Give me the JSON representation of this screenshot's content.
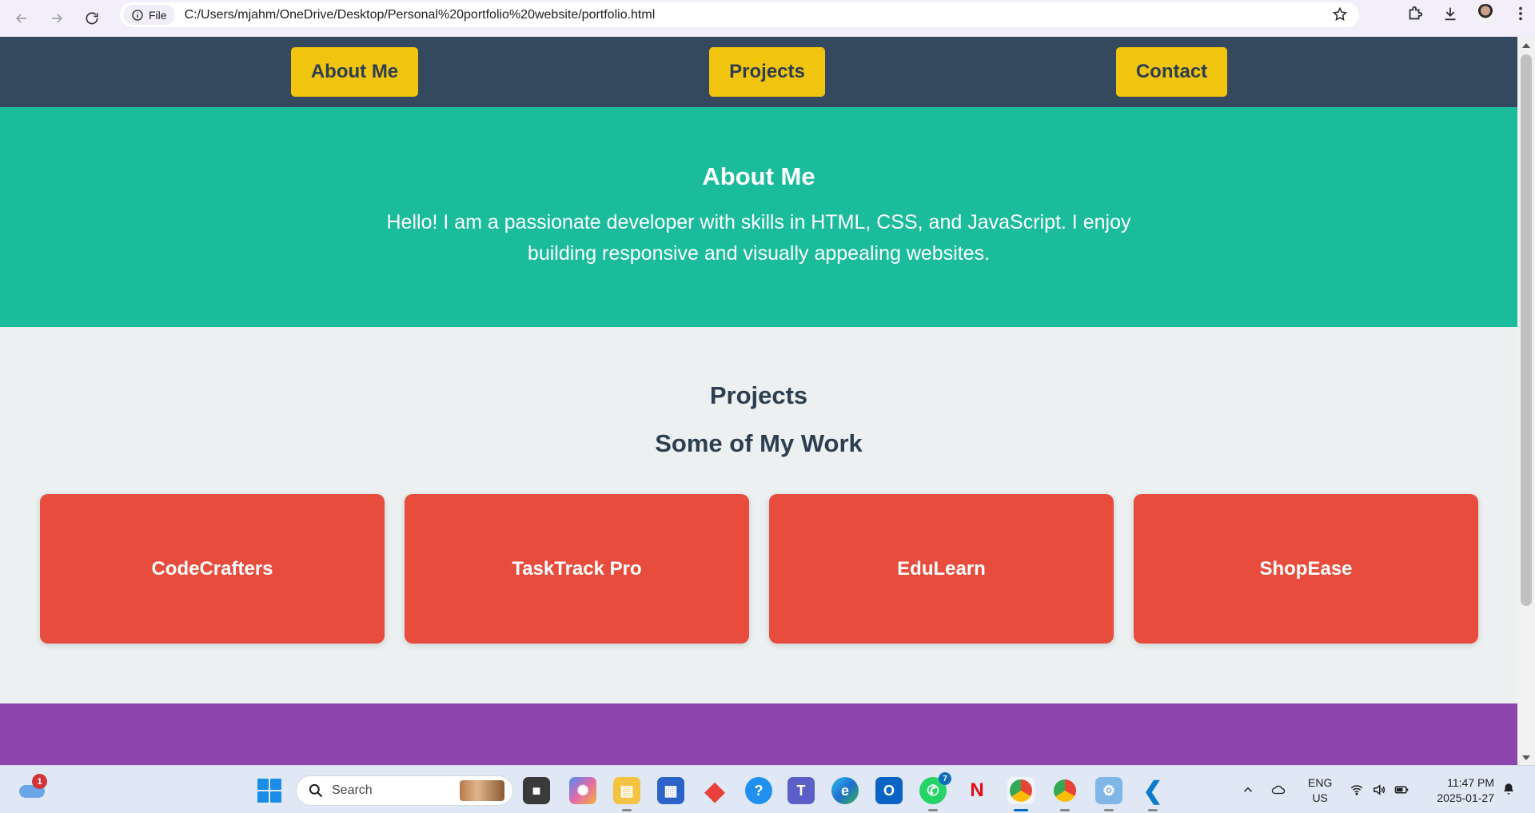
{
  "browser": {
    "site_chip_label": "File",
    "url": "C:/Users/mjahm/OneDrive/Desktop/Personal%20portfolio%20website/portfolio.html"
  },
  "nav": {
    "about_label": "About Me",
    "projects_label": "Projects",
    "contact_label": "Contact"
  },
  "about": {
    "heading": "About Me",
    "text": "Hello! I am a passionate developer with skills in HTML, CSS, and JavaScript. I enjoy building responsive and visually appealing websites."
  },
  "projects": {
    "heading": "Projects",
    "subheading": "Some of My Work",
    "cards": [
      {
        "title": "CodeCrafters"
      },
      {
        "title": "TaskTrack Pro"
      },
      {
        "title": "EduLearn"
      },
      {
        "title": "ShopEase"
      }
    ]
  },
  "colors": {
    "nav_bg": "#34495e",
    "nav_button": "#f1c40f",
    "about_bg": "#1abc9c",
    "projects_bg": "#ecf0f1",
    "card_bg": "#e74c3c",
    "contact_bg": "#8e44ad"
  },
  "taskbar": {
    "weather_badge": "1",
    "search_placeholder": "Search",
    "apps": [
      {
        "name": "task-view"
      },
      {
        "name": "copilot"
      },
      {
        "name": "file-explorer"
      },
      {
        "name": "microsoft-store"
      },
      {
        "name": "git-app"
      },
      {
        "name": "help-app"
      },
      {
        "name": "teams"
      },
      {
        "name": "edge"
      },
      {
        "name": "outlook"
      },
      {
        "name": "whatsapp",
        "badge": "7"
      },
      {
        "name": "netflix"
      },
      {
        "name": "chrome-profile"
      },
      {
        "name": "chrome"
      },
      {
        "name": "control-panel"
      },
      {
        "name": "vscode"
      }
    ],
    "lang_primary": "ENG",
    "lang_secondary": "US",
    "time": "11:47 PM",
    "date": "2025-01-27"
  }
}
